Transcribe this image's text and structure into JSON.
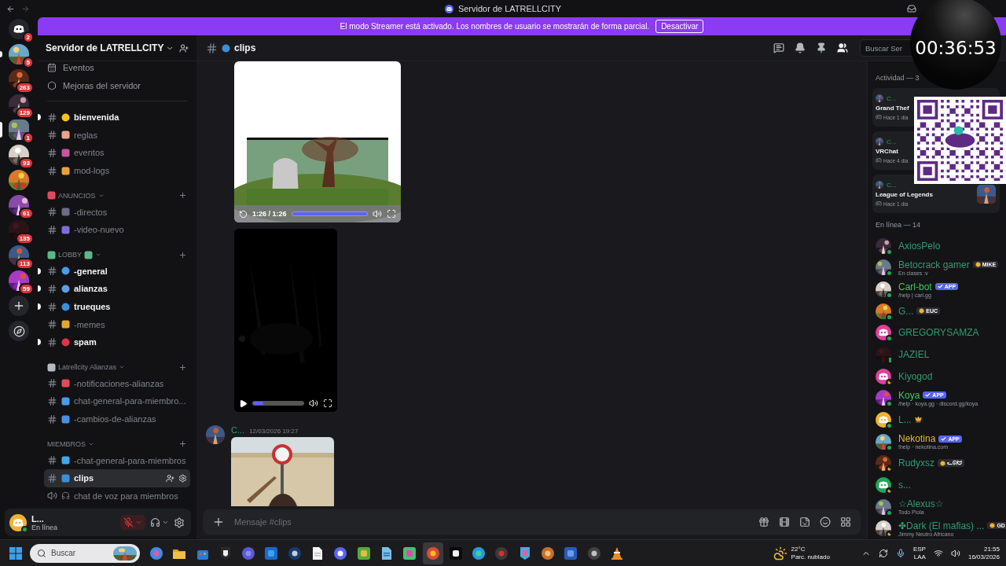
{
  "window": {
    "title": "Servidor de LATRELLCITY"
  },
  "banner": {
    "text": "El modo Streamer está activado. Los nombres de usuario se mostrarán de forma parcial.",
    "button": "Desactivar"
  },
  "servers": [
    {
      "kind": "home",
      "badge": "2",
      "selected": false,
      "unread": false
    },
    {
      "kind": "server",
      "badge": "5",
      "selected": false,
      "unread": true
    },
    {
      "kind": "server",
      "badge": "263",
      "selected": false,
      "unread": false
    },
    {
      "kind": "server",
      "badge": "129",
      "selected": false,
      "unread": false
    },
    {
      "kind": "server",
      "badge": "1",
      "selected": true,
      "unread": false
    },
    {
      "kind": "server",
      "badge": "93",
      "selected": false,
      "unread": false
    },
    {
      "kind": "server",
      "selected": false,
      "unread": false
    },
    {
      "kind": "server",
      "badge": "61",
      "selected": false,
      "unread": false
    },
    {
      "kind": "server",
      "badge": "135",
      "selected": false,
      "unread": false
    },
    {
      "kind": "server",
      "badge": "113",
      "selected": false,
      "unread": false
    },
    {
      "kind": "server",
      "badge": "59",
      "selected": false,
      "unread": false
    },
    {
      "kind": "add",
      "selected": false,
      "unread": false
    },
    {
      "kind": "discover",
      "selected": false,
      "unread": false
    }
  ],
  "sidebar": {
    "server_name": "Servidor de LATRELLCITY",
    "links": [
      {
        "kind": "events",
        "label": "Eventos"
      },
      {
        "kind": "boosts",
        "label": "Mejoras del servidor"
      }
    ],
    "sections": [
      {
        "channels": [
          {
            "name": "bienvenida",
            "kind": "text",
            "color": "#f5c518",
            "unread": true,
            "selected": false
          },
          {
            "name": "reglas",
            "kind": "text",
            "color": "#e8a38a",
            "unread": false,
            "selected": false
          },
          {
            "name": "eventos",
            "kind": "text",
            "color": "#c7559d",
            "unread": false,
            "selected": false
          },
          {
            "name": "mod-logs",
            "kind": "locked",
            "color": "#e8a13a",
            "unread": false,
            "selected": false
          }
        ]
      },
      {
        "name": "ANUNCIOS",
        "color": "#e04a5f",
        "trailing": false,
        "channels": [
          {
            "name": "-directos",
            "kind": "text",
            "color": "#6d6a8a",
            "unread": false,
            "selected": false
          },
          {
            "name": "-video-nuevo",
            "kind": "text",
            "color": "#7b6fd6",
            "unread": false,
            "selected": false
          }
        ]
      },
      {
        "name": "LOBBY",
        "color": "#5fb58a",
        "trailing": true,
        "channels": [
          {
            "name": "-general",
            "kind": "text",
            "color": "#4a9be8",
            "unread": true,
            "selected": false
          },
          {
            "name": "alianzas",
            "kind": "text",
            "color": "#5aa0e6",
            "unread": true,
            "selected": false
          },
          {
            "name": "trueques",
            "kind": "text",
            "color": "#3b8fd9",
            "unread": true,
            "selected": false
          },
          {
            "name": "-memes",
            "kind": "text",
            "color": "#e0a92e",
            "unread": false,
            "selected": false
          },
          {
            "name": "spam",
            "kind": "text",
            "color": "#e0334a",
            "unread": true,
            "selected": false
          }
        ]
      },
      {
        "name": "Latrellcity Alianzas",
        "color": "#b5bac1",
        "trailing": false,
        "channels": [
          {
            "name": "-notificaciones-alianzas",
            "kind": "locked",
            "color": "#e04a5f",
            "unread": false,
            "selected": false
          },
          {
            "name": "chat-general-para-miembro...",
            "kind": "locked",
            "color": "#4a9be8",
            "unread": false,
            "selected": false
          },
          {
            "name": "-cambios-de-alianzas",
            "kind": "locked",
            "color": "#4a8fe0",
            "unread": false,
            "selected": false
          }
        ]
      },
      {
        "name": "MIEMBROS",
        "trailing": false,
        "channels": [
          {
            "name": "-chat-general-para-miembros",
            "kind": "text",
            "color": "#3fa8e8",
            "unread": false,
            "selected": false
          },
          {
            "name": "clips",
            "kind": "text",
            "color": "#3b8fd9",
            "unread": false,
            "selected": true
          },
          {
            "name": "chat de voz para miembros",
            "kind": "voice",
            "unread": false,
            "selected": false
          }
        ]
      }
    ]
  },
  "user_panel": {
    "name": "L...",
    "status": "En línea",
    "muted": true
  },
  "header": {
    "channel": "clips",
    "members_shown": true,
    "search": {
      "placeholder": "Buscar Ser"
    }
  },
  "messages": [
    {
      "attachments": [
        {
          "kind": "video",
          "ended": true,
          "time": "1:26 / 1:26",
          "level": 1
        },
        {
          "kind": "video",
          "ended": false,
          "level": 0.2
        }
      ]
    },
    {
      "author": "C...",
      "timestamp": "12/03/2026 19:27"
    }
  ],
  "composer": {
    "placeholder": "Mensaje #clips"
  },
  "activity": {
    "title": "Actividad — 3",
    "items": [
      {
        "user": "C...",
        "game": "Grand Thef",
        "time": "Hace 1 día",
        "art": false
      },
      {
        "user": "C...",
        "game": "VRChat",
        "time": "Hace 4 día",
        "art": false
      },
      {
        "user": "C...",
        "game": "League of Legends",
        "time": "Hace 1 día",
        "art": true
      }
    ]
  },
  "members": {
    "title": "En línea — 14",
    "items": [
      {
        "name": "AxiosPelo",
        "color": "#2f9d6f",
        "idle": false,
        "mobile": false,
        "owner": false
      },
      {
        "name": "Betocrack gamer",
        "color": "#2f9d6f",
        "idle": false,
        "mobile": false,
        "owner": false,
        "tag": {
          "kind": "badge",
          "text": "MIKE"
        },
        "sub": "En clases :v"
      },
      {
        "name": "Carl-bot",
        "color": "#43c463",
        "idle": false,
        "mobile": false,
        "owner": false,
        "tag": {
          "kind": "app",
          "text": "APP"
        },
        "sub": "/help | carl.gg"
      },
      {
        "name": "G...",
        "color": "#2f9d6f",
        "idle": false,
        "mobile": false,
        "owner": false,
        "tag": {
          "kind": "badge",
          "text": "EUC"
        }
      },
      {
        "name": "GREGORYSAMZA",
        "color": "#2f9d6f",
        "idle": false,
        "mobile": false,
        "avatar": {
          "kind": "default",
          "color": "#e0409a"
        },
        "owner": false
      },
      {
        "name": "JAZIEL",
        "color": "#2f9d6f",
        "idle": false,
        "mobile": true,
        "owner": false
      },
      {
        "name": "Kiyogod",
        "color": "#2f9d6f",
        "idle": true,
        "mobile": false,
        "avatar": {
          "kind": "default",
          "color": "#e0409a"
        },
        "owner": false
      },
      {
        "name": "Koya",
        "color": "#43c463",
        "idle": false,
        "mobile": false,
        "owner": false,
        "tag": {
          "kind": "app",
          "text": "APP"
        },
        "sub": "/help · koya.gg · discord.gg/koya"
      },
      {
        "name": "L...",
        "color": "#2f9d6f",
        "idle": false,
        "mobile": false,
        "avatar": {
          "kind": "default",
          "color": "#f0b232"
        },
        "owner": true
      },
      {
        "name": "Nekotina",
        "color": "#e6b735",
        "idle": false,
        "mobile": false,
        "owner": false,
        "tag": {
          "kind": "app",
          "text": "APP"
        },
        "sub": "!help · nekotina.com"
      },
      {
        "name": "Rudyxsz",
        "color": "#2f9d6f",
        "idle": true,
        "mobile": false,
        "owner": false,
        "tag": {
          "kind": "badge",
          "text": "ᓚᘏᗢ"
        }
      },
      {
        "name": "s...",
        "color": "#2f9d6f",
        "idle": true,
        "mobile": false,
        "avatar": {
          "kind": "default",
          "color": "#23a55a"
        },
        "owner": false
      },
      {
        "name": "☆Alexus☆",
        "color": "#2f9d6f",
        "idle": false,
        "mobile": false,
        "owner": false,
        "sub": "Todo Piola"
      },
      {
        "name": "✤Dark (El mafias) ...",
        "color": "#2f9d6f",
        "idle": true,
        "mobile": false,
        "owner": false,
        "tag": {
          "kind": "badge",
          "text": "GD"
        },
        "sub": "Jimmy Neutro Africano"
      }
    ]
  },
  "overlay": {
    "timer": "00:36:53"
  },
  "taskbar": {
    "search": {
      "placeholder": "Buscar"
    },
    "apps": [
      {
        "kind": "swirl",
        "selected": false
      },
      {
        "kind": "folder",
        "selected": false
      },
      {
        "kind": "store",
        "selected": false
      },
      {
        "kind": "shield",
        "selected": false
      },
      {
        "kind": "people",
        "selected": false
      },
      {
        "kind": "mail",
        "selected": false
      },
      {
        "kind": "wheel",
        "selected": false
      },
      {
        "kind": "document",
        "selected": false
      },
      {
        "kind": "controller",
        "selected": false
      },
      {
        "kind": "game",
        "selected": false
      },
      {
        "kind": "notepad",
        "selected": false
      },
      {
        "kind": "chat",
        "selected": false
      },
      {
        "kind": "browser",
        "selected": true
      },
      {
        "kind": "editor",
        "selected": false
      },
      {
        "kind": "wave",
        "selected": false
      },
      {
        "kind": "timer",
        "selected": false
      },
      {
        "kind": "gem",
        "selected": false
      },
      {
        "kind": "glove",
        "selected": false
      },
      {
        "kind": "word",
        "selected": false
      },
      {
        "kind": "record",
        "selected": false
      },
      {
        "kind": "cone",
        "selected": false
      }
    ],
    "weather": {
      "temp": "22°C",
      "text": "Parc. nublado"
    },
    "language": {
      "lang": "ESP",
      "layout": "LAA"
    },
    "clock": {
      "time": "21:55",
      "date": "16/03/2026"
    }
  }
}
